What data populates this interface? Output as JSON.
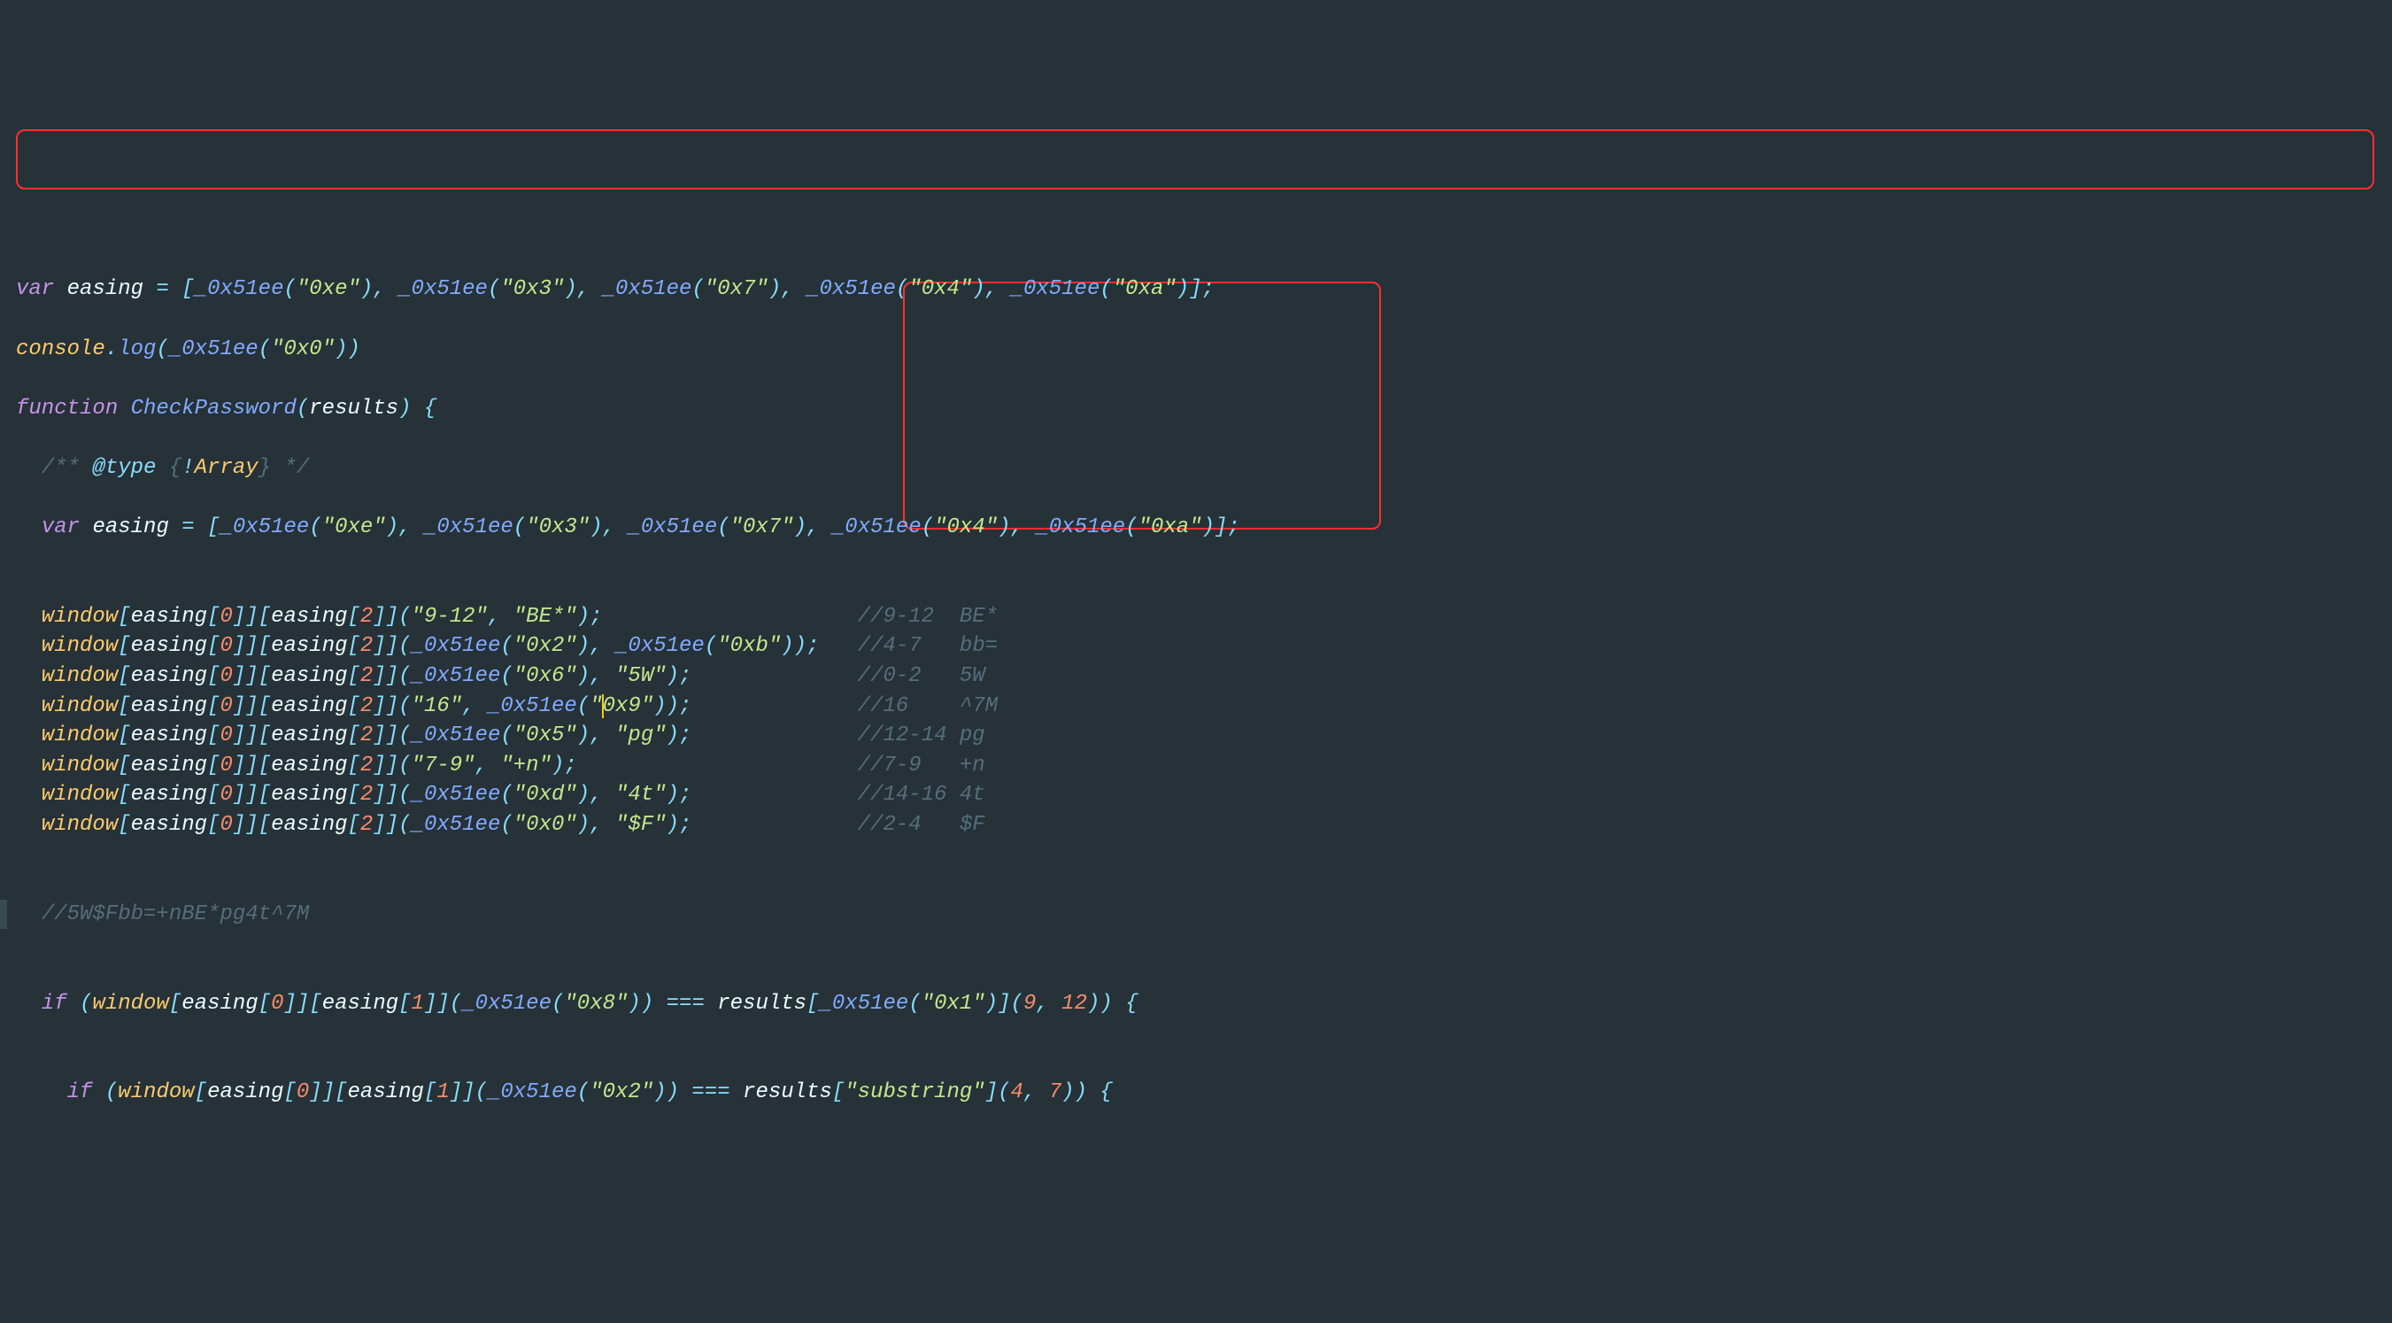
{
  "lines": {
    "l1": {
      "var_kw": "var",
      "ident": "easing",
      "assign": " = ",
      "open": "[",
      "items": [
        {
          "fn": "_0x51ee",
          "arg": "\"0xe\""
        },
        {
          "fn": "_0x51ee",
          "arg": "\"0x3\""
        },
        {
          "fn": "_0x51ee",
          "arg": "\"0x7\""
        },
        {
          "fn": "_0x51ee",
          "arg": "\"0x4\""
        },
        {
          "fn": "_0x51ee",
          "arg": "\"0xa\""
        }
      ],
      "close": "];"
    },
    "l2": {
      "obj": "console",
      "dot": ".",
      "method": "log",
      "open": "(",
      "fn": "_0x51ee",
      "popen": "(",
      "arg": "\"0x0\"",
      "pclose": ")",
      "close": ")"
    },
    "l3": {
      "kw": "function",
      "name": "CheckPassword",
      "open": "(",
      "param": "results",
      "close": ")",
      "brace": " {"
    },
    "l4": {
      "comment_open": "/** ",
      "at_type": "@type",
      "type_open": " {",
      "bang": "!",
      "type_name": "Array",
      "type_close": "}",
      "comment_close": " */"
    },
    "l5": {
      "var_kw": "var",
      "ident": "easing",
      "assign": " = ",
      "open": "[",
      "items": [
        {
          "fn": "_0x51ee",
          "arg": "\"0xe\""
        },
        {
          "fn": "_0x51ee",
          "arg": "\"0x3\""
        },
        {
          "fn": "_0x51ee",
          "arg": "\"0x7\""
        },
        {
          "fn": "_0x51ee",
          "arg": "\"0x4\""
        },
        {
          "fn": "_0x51ee",
          "arg": "\"0xa\""
        }
      ],
      "close": "];"
    },
    "calls": [
      {
        "args": [
          {
            "type": "str",
            "v": "\"9-12\""
          },
          {
            "type": "str",
            "v": "\"BE*\""
          }
        ],
        "comment": "//9-12  BE*"
      },
      {
        "args": [
          {
            "type": "fn",
            "v": "\"0x2\""
          },
          {
            "type": "fn",
            "v": "\"0xb\""
          }
        ],
        "comment": "//4-7   bb="
      },
      {
        "args": [
          {
            "type": "fn",
            "v": "\"0x6\""
          },
          {
            "type": "str",
            "v": "\"5W\""
          }
        ],
        "comment": "//0-2   5W"
      },
      {
        "args": [
          {
            "type": "str",
            "v": "\"16\""
          },
          {
            "type": "fn",
            "v": "\"0x9\"",
            "cursor": true
          }
        ],
        "comment": "//16    ^7M"
      },
      {
        "args": [
          {
            "type": "fn",
            "v": "\"0x5\""
          },
          {
            "type": "str",
            "v": "\"pg\""
          }
        ],
        "comment": "//12-14 pg"
      },
      {
        "args": [
          {
            "type": "str",
            "v": "\"7-9\""
          },
          {
            "type": "str",
            "v": "\"+n\""
          }
        ],
        "comment": "//7-9   +n"
      },
      {
        "args": [
          {
            "type": "fn",
            "v": "\"0xd\""
          },
          {
            "type": "str",
            "v": "\"4t\""
          }
        ],
        "comment": "//14-16 4t"
      },
      {
        "args": [
          {
            "type": "fn",
            "v": "\"0x0\""
          },
          {
            "type": "str",
            "v": "\"$F\""
          }
        ],
        "comment": "//2-4   $F"
      }
    ],
    "call_prefix": {
      "obj": "window",
      "open1": "[",
      "ident": "easing",
      "open2": "[",
      "idx0": "0",
      "close2": "]",
      "close1": "]",
      "open3": "[",
      "ident2": "easing",
      "open4": "[",
      "idx2": "2",
      "close4": "]",
      "close3": "]",
      "popen": "("
    },
    "call_suffix": ");",
    "call_fn": "_0x51ee",
    "comment_col_pad": 66,
    "l14": {
      "comment": "//5W$Fbb=+nBE*pg4t^7M"
    },
    "l15": {
      "kw": "if",
      "open": " (",
      "obj": "window",
      "b1o": "[",
      "e1": "easing",
      "i1o": "[",
      "i1": "0",
      "i1c": "]",
      "b1c": "]",
      "b2o": "[",
      "e2": "easing",
      "i2o": "[",
      "i2": "1",
      "i2c": "]",
      "b2c": "]",
      "popen": "(",
      "fn": "_0x51ee",
      "fpo": "(",
      "farg": "\"0x8\"",
      "fpc": ")",
      "pclose": ")",
      "eq": " === ",
      "res": "results",
      "ro": "[",
      "rfn": "_0x51ee",
      "rfpo": "(",
      "rfarg": "\"0x1\"",
      "rfpc": ")",
      "rc": "]",
      "ao": "(",
      "a1": "9",
      "comma": ", ",
      "a2": "12",
      "ac": ")",
      "close": ") {"
    },
    "l16": {
      "kw": "if",
      "open": " (",
      "obj": "window",
      "b1o": "[",
      "e1": "easing",
      "i1o": "[",
      "i1": "0",
      "i1c": "]",
      "b1c": "]",
      "b2o": "[",
      "e2": "easing",
      "i2o": "[",
      "i2": "1",
      "i2c": "]",
      "b2c": "]",
      "popen": "(",
      "fn": "_0x51ee",
      "fpo": "(",
      "farg": "\"0x2\"",
      "fpc": ")",
      "pclose": ")",
      "eq": " === ",
      "res": "results",
      "ro": "[",
      "rstr": "\"substring\"",
      "rc": "]",
      "ao": "(",
      "a1": "4",
      "comma": ", ",
      "a2": "7",
      "ac": ")",
      "close": ") {"
    },
    "indent1": "  ",
    "indent2": "    "
  }
}
